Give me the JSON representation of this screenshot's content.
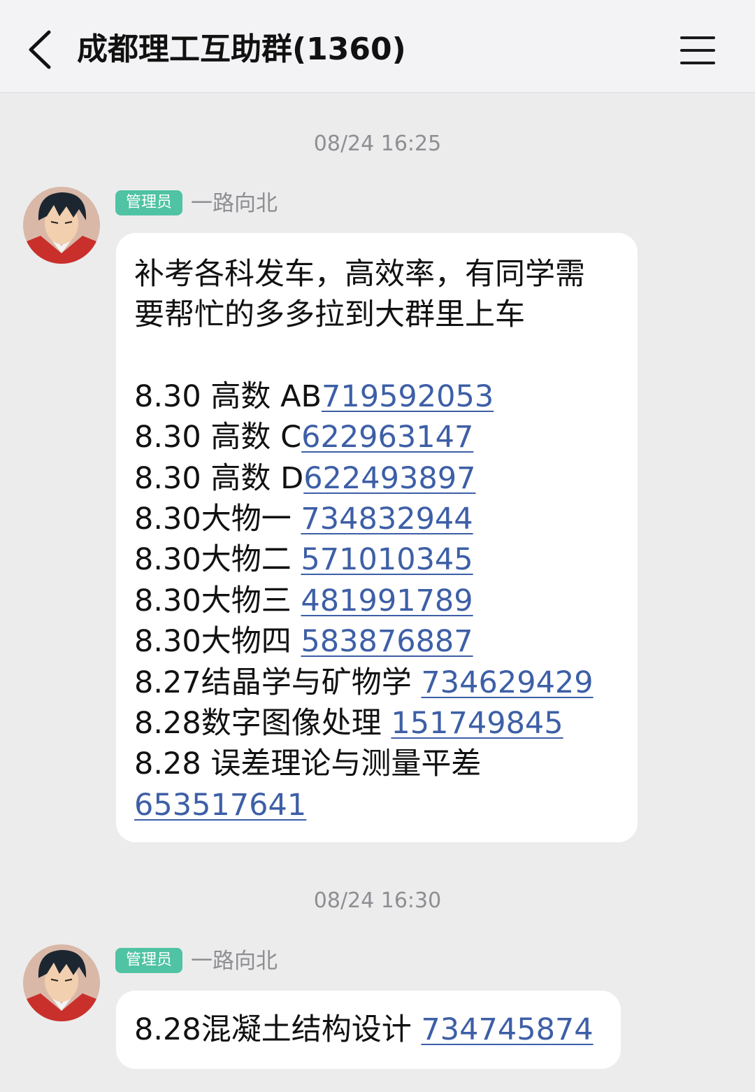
{
  "header": {
    "title": "成都理工互助群(1360)"
  },
  "messages": [
    {
      "timestamp": "08/24 16:25",
      "role_badge": "管理员",
      "sender": "一路向北",
      "intro_lines": [
        "补考各科发车，高效率，有同学需",
        "要帮忙的多多拉到大群里上车"
      ],
      "items": [
        {
          "label": "8.30 高数 AB",
          "code": "719592053"
        },
        {
          "label": "8.30 高数 C",
          "code": "622963147"
        },
        {
          "label": "8.30 高数 D",
          "code": "622493897"
        },
        {
          "label": "8.30大物一 ",
          "code": "734832944"
        },
        {
          "label": "8.30大物二 ",
          "code": "571010345"
        },
        {
          "label": "8.30大物三 ",
          "code": "481991789"
        },
        {
          "label": "8.30大物四 ",
          "code": "583876887"
        },
        {
          "label": "8.27结晶学与矿物学 ",
          "code": "734629429"
        },
        {
          "label": "8.28数字图像处理 ",
          "code": "151749845"
        }
      ],
      "last_item": {
        "label": "8.28 误差理论与测量平差",
        "code": "653517641"
      }
    },
    {
      "timestamp": "08/24 16:30",
      "role_badge": "管理员",
      "sender": "一路向北",
      "items": [
        {
          "label": "8.28混凝土结构设计 ",
          "code": "734745874"
        }
      ]
    }
  ],
  "colors": {
    "background": "#ececec",
    "link": "#3d5fa6",
    "badge": "#4fc3a3"
  },
  "icons": {
    "back": "chevron-left-icon",
    "menu": "hamburger-menu-icon"
  }
}
